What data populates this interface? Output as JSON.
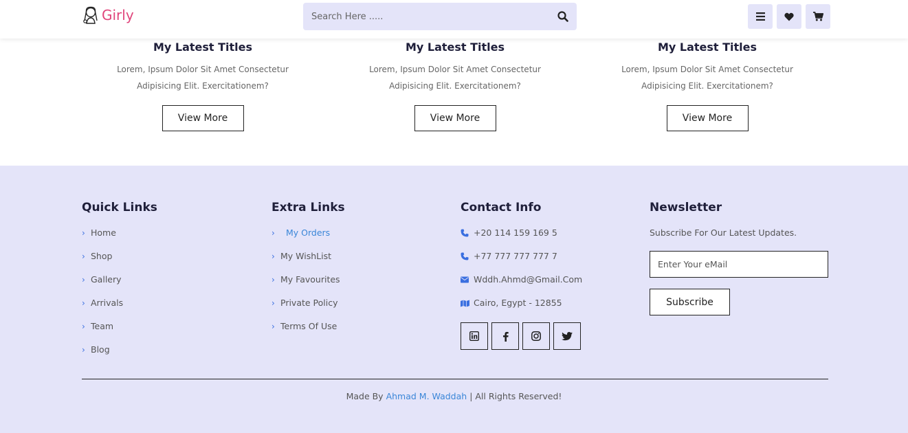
{
  "header": {
    "logo_text": "Girly",
    "search_placeholder": "Search Here .....",
    "icons": [
      "menu-icon",
      "heart-icon",
      "cart-icon"
    ]
  },
  "cards": [
    {
      "title": "My Latest Titles",
      "text": "Lorem, Ipsum Dolor Sit Amet Consectetur Adipisicing Elit. Exercitationem?",
      "button": "View More"
    },
    {
      "title": "My Latest Titles",
      "text": "Lorem, Ipsum Dolor Sit Amet Consectetur Adipisicing Elit. Exercitationem?",
      "button": "View More"
    },
    {
      "title": "My Latest Titles",
      "text": "Lorem, Ipsum Dolor Sit Amet Consectetur Adipisicing Elit. Exercitationem?",
      "button": "View More"
    }
  ],
  "footer": {
    "quick_links": {
      "title": "Quick Links",
      "items": [
        "Home",
        "Shop",
        "Gallery",
        "Arrivals",
        "Team",
        "Blog"
      ]
    },
    "extra_links": {
      "title": "Extra Links",
      "items": [
        "My Orders",
        "My WishList",
        "My Favourites",
        "Private Policy",
        "Terms Of Use"
      ]
    },
    "contact": {
      "title": "Contact Info",
      "items": [
        {
          "icon": "phone-icon",
          "text": "+20 114 159 169 5"
        },
        {
          "icon": "phone-icon",
          "text": "+77 777 777 777 7"
        },
        {
          "icon": "envelope-icon",
          "text": "Wddh.Ahmd@Gmail.Com"
        },
        {
          "icon": "map-icon",
          "text": "Cairo, Egypt - 12855"
        }
      ],
      "socials": [
        "linkedin-icon",
        "facebook-icon",
        "instagram-icon",
        "twitter-icon"
      ]
    },
    "newsletter": {
      "title": "Newsletter",
      "text": "Subscribe For Our Latest Updates.",
      "input_placeholder": "Enter Your eMail",
      "button": "Subscribe"
    },
    "credit": {
      "prefix": "Made By",
      "author": "Ahmad M. Waddah",
      "suffix": "| All Rights Reserved!"
    }
  },
  "colors": {
    "brand": "#e0457b",
    "accent_bg": "#e4e4f9",
    "link_active": "#3a86d8",
    "icon_blue": "#3a6fe0"
  }
}
